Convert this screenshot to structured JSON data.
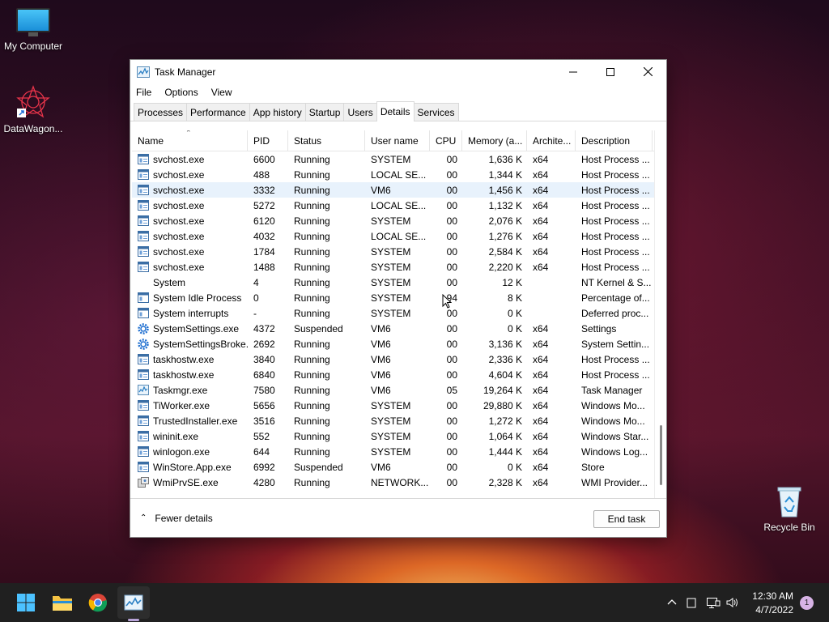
{
  "desktop": {
    "icons": [
      {
        "label": "My Computer"
      },
      {
        "label": "DataWagon..."
      },
      {
        "label": "Recycle Bin"
      }
    ]
  },
  "window": {
    "title": "Task Manager",
    "menu": [
      "File",
      "Options",
      "View"
    ],
    "tabs": [
      "Processes",
      "Performance",
      "App history",
      "Startup",
      "Users",
      "Details",
      "Services"
    ],
    "active_tab": "Details",
    "columns": [
      "Name",
      "PID",
      "Status",
      "User name",
      "CPU",
      "Memory (a...",
      "Archite...",
      "Description"
    ],
    "rows": [
      {
        "name": "svchost.exe",
        "pid": "6600",
        "status": "Running",
        "user": "SYSTEM",
        "cpu": "00",
        "mem": "1,636 K",
        "arch": "x64",
        "desc": "Host Process ...",
        "icon": "service-icon"
      },
      {
        "name": "svchost.exe",
        "pid": "488",
        "status": "Running",
        "user": "LOCAL SE...",
        "cpu": "00",
        "mem": "1,344 K",
        "arch": "x64",
        "desc": "Host Process ...",
        "icon": "service-icon"
      },
      {
        "name": "svchost.exe",
        "pid": "3332",
        "status": "Running",
        "user": "VM6",
        "cpu": "00",
        "mem": "1,456 K",
        "arch": "x64",
        "desc": "Host Process ...",
        "icon": "service-icon",
        "selected": true
      },
      {
        "name": "svchost.exe",
        "pid": "5272",
        "status": "Running",
        "user": "LOCAL SE...",
        "cpu": "00",
        "mem": "1,132 K",
        "arch": "x64",
        "desc": "Host Process ...",
        "icon": "service-icon"
      },
      {
        "name": "svchost.exe",
        "pid": "6120",
        "status": "Running",
        "user": "SYSTEM",
        "cpu": "00",
        "mem": "2,076 K",
        "arch": "x64",
        "desc": "Host Process ...",
        "icon": "service-icon"
      },
      {
        "name": "svchost.exe",
        "pid": "4032",
        "status": "Running",
        "user": "LOCAL SE...",
        "cpu": "00",
        "mem": "1,276 K",
        "arch": "x64",
        "desc": "Host Process ...",
        "icon": "service-icon"
      },
      {
        "name": "svchost.exe",
        "pid": "1784",
        "status": "Running",
        "user": "SYSTEM",
        "cpu": "00",
        "mem": "2,584 K",
        "arch": "x64",
        "desc": "Host Process ...",
        "icon": "service-icon"
      },
      {
        "name": "svchost.exe",
        "pid": "1488",
        "status": "Running",
        "user": "SYSTEM",
        "cpu": "00",
        "mem": "2,220 K",
        "arch": "x64",
        "desc": "Host Process ...",
        "icon": "service-icon"
      },
      {
        "name": "System",
        "pid": "4",
        "status": "Running",
        "user": "SYSTEM",
        "cpu": "00",
        "mem": "12 K",
        "arch": "",
        "desc": "NT Kernel & S...",
        "icon": "none"
      },
      {
        "name": "System Idle Process",
        "pid": "0",
        "status": "Running",
        "user": "SYSTEM",
        "cpu": "94",
        "mem": "8 K",
        "arch": "",
        "desc": "Percentage of...",
        "icon": "window-icon"
      },
      {
        "name": "System interrupts",
        "pid": "-",
        "status": "Running",
        "user": "SYSTEM",
        "cpu": "00",
        "mem": "0 K",
        "arch": "",
        "desc": "Deferred proc...",
        "icon": "window-icon"
      },
      {
        "name": "SystemSettings.exe",
        "pid": "4372",
        "status": "Suspended",
        "user": "VM6",
        "cpu": "00",
        "mem": "0 K",
        "arch": "x64",
        "desc": "Settings",
        "icon": "gear-icon"
      },
      {
        "name": "SystemSettingsBroke...",
        "pid": "2692",
        "status": "Running",
        "user": "VM6",
        "cpu": "00",
        "mem": "3,136 K",
        "arch": "x64",
        "desc": "System Settin...",
        "icon": "gear-icon"
      },
      {
        "name": "taskhostw.exe",
        "pid": "3840",
        "status": "Running",
        "user": "VM6",
        "cpu": "00",
        "mem": "2,336 K",
        "arch": "x64",
        "desc": "Host Process ...",
        "icon": "service-icon"
      },
      {
        "name": "taskhostw.exe",
        "pid": "6840",
        "status": "Running",
        "user": "VM6",
        "cpu": "00",
        "mem": "4,604 K",
        "arch": "x64",
        "desc": "Host Process ...",
        "icon": "service-icon"
      },
      {
        "name": "Taskmgr.exe",
        "pid": "7580",
        "status": "Running",
        "user": "VM6",
        "cpu": "05",
        "mem": "19,264 K",
        "arch": "x64",
        "desc": "Task Manager",
        "icon": "task-manager-icon"
      },
      {
        "name": "TiWorker.exe",
        "pid": "5656",
        "status": "Running",
        "user": "SYSTEM",
        "cpu": "00",
        "mem": "29,880 K",
        "arch": "x64",
        "desc": "Windows Mo...",
        "icon": "service-icon"
      },
      {
        "name": "TrustedInstaller.exe",
        "pid": "3516",
        "status": "Running",
        "user": "SYSTEM",
        "cpu": "00",
        "mem": "1,272 K",
        "arch": "x64",
        "desc": "Windows Mo...",
        "icon": "service-icon"
      },
      {
        "name": "wininit.exe",
        "pid": "552",
        "status": "Running",
        "user": "SYSTEM",
        "cpu": "00",
        "mem": "1,064 K",
        "arch": "x64",
        "desc": "Windows Star...",
        "icon": "service-icon"
      },
      {
        "name": "winlogon.exe",
        "pid": "644",
        "status": "Running",
        "user": "SYSTEM",
        "cpu": "00",
        "mem": "1,444 K",
        "arch": "x64",
        "desc": "Windows Log...",
        "icon": "service-icon"
      },
      {
        "name": "WinStore.App.exe",
        "pid": "6992",
        "status": "Suspended",
        "user": "VM6",
        "cpu": "00",
        "mem": "0 K",
        "arch": "x64",
        "desc": "Store",
        "icon": "service-icon"
      },
      {
        "name": "WmiPrvSE.exe",
        "pid": "4280",
        "status": "Running",
        "user": "NETWORK...",
        "cpu": "00",
        "mem": "2,328 K",
        "arch": "x64",
        "desc": "WMI Provider...",
        "icon": "wmi-icon"
      }
    ],
    "fewer_details": "Fewer details",
    "end_task": "End task"
  },
  "taskbar": {
    "time": "12:30 AM",
    "date": "4/7/2022",
    "notification_count": "1"
  }
}
